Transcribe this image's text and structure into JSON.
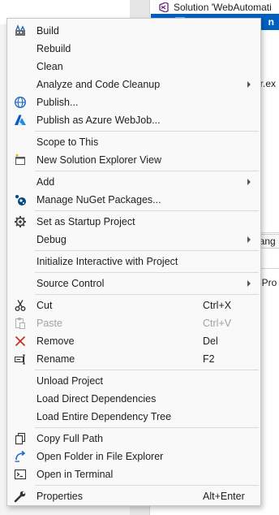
{
  "background": {
    "solution_label": "Solution 'WebAutomati",
    "selected_row_suffix": "n",
    "partial_text_1": "er.ex",
    "partial_tab_label": "hang",
    "partial_text_2": "t Pro"
  },
  "menu": {
    "items": [
      {
        "label": "Build",
        "icon": "build-icon"
      },
      {
        "label": "Rebuild"
      },
      {
        "label": "Clean"
      },
      {
        "label": "Analyze and Code Cleanup",
        "submenu": true
      },
      {
        "label": "Publish...",
        "icon": "globe-icon"
      },
      {
        "label": "Publish as Azure WebJob...",
        "icon": "azure-icon"
      },
      {
        "label": "Scope to This"
      },
      {
        "label": "New Solution Explorer View",
        "icon": "new-view-icon"
      },
      {
        "label": "Add",
        "submenu": true
      },
      {
        "label": "Manage NuGet Packages...",
        "icon": "nuget-icon"
      },
      {
        "label": "Set as Startup Project",
        "icon": "gear-icon"
      },
      {
        "label": "Debug",
        "submenu": true
      },
      {
        "label": "Initialize Interactive with Project"
      },
      {
        "label": "Source Control",
        "submenu": true
      },
      {
        "label": "Cut",
        "shortcut": "Ctrl+X",
        "icon": "scissors-icon"
      },
      {
        "label": "Paste",
        "shortcut": "Ctrl+V",
        "icon": "paste-icon",
        "disabled": true
      },
      {
        "label": "Remove",
        "shortcut": "Del",
        "icon": "remove-icon"
      },
      {
        "label": "Rename",
        "shortcut": "F2",
        "icon": "rename-icon"
      },
      {
        "label": "Unload Project"
      },
      {
        "label": "Load Direct Dependencies"
      },
      {
        "label": "Load Entire Dependency Tree"
      },
      {
        "label": "Copy Full Path",
        "icon": "copy-icon"
      },
      {
        "label": "Open Folder in File Explorer",
        "icon": "open-folder-icon"
      },
      {
        "label": "Open in Terminal",
        "icon": "terminal-icon"
      },
      {
        "label": "Properties",
        "shortcut": "Alt+Enter",
        "icon": "wrench-icon"
      }
    ]
  }
}
